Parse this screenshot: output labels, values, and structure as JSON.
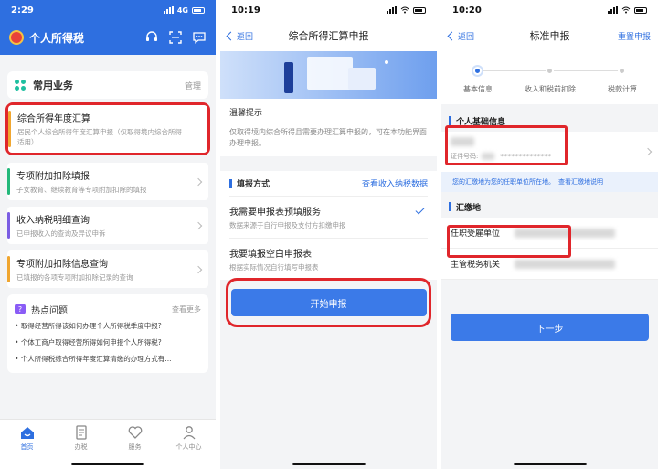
{
  "panel1": {
    "status": {
      "time": "2:29",
      "net": "4G"
    },
    "app_title": "个人所得税",
    "common": {
      "title": "常用业务",
      "manage": "管理"
    },
    "items": [
      {
        "title": "综合所得年度汇算",
        "desc": "居民个人综合所得年度汇算申报（仅取得境内综合所得适用）"
      },
      {
        "title": "专项附加扣除填报",
        "desc": "子女教育、继续教育等专项附加扣除的填报"
      },
      {
        "title": "收入纳税明细查询",
        "desc": "已申报收入的查询及异议申诉"
      },
      {
        "title": "专项附加扣除信息查询",
        "desc": "已填报的各项专项附加扣除记录的查询"
      }
    ],
    "hot": {
      "title": "热点问题",
      "more": "查看更多",
      "items": [
        "取得经营所得该如何办理个人所得税季度申报?",
        "个体工商户取得经营所得如何申报个人所得税?",
        "个人所得税综合所得年度汇算清缴的办理方式有..."
      ]
    },
    "tabs": [
      {
        "label": "首页",
        "icon": "home-icon"
      },
      {
        "label": "办税",
        "icon": "document-icon"
      },
      {
        "label": "服务",
        "icon": "heart-icon"
      },
      {
        "label": "个人中心",
        "icon": "person-icon"
      }
    ]
  },
  "panel2": {
    "status": {
      "time": "10:19"
    },
    "back": "返回",
    "title": "综合所得汇算申报",
    "tip": {
      "title": "温馨提示",
      "desc": "仅取得境内综合所得且需要办理汇算申报的，可在本功能界面办理申报。"
    },
    "fill": {
      "title": "填报方式",
      "link": "查看收入纳税数据",
      "options": [
        {
          "title": "我需要申报表预填服务",
          "desc": "数据来源于自行申报及支付方扣缴申报"
        },
        {
          "title": "我要填报空白申报表",
          "desc": "根据实际情况自行填写申报表"
        }
      ]
    },
    "start": "开始申报"
  },
  "panel3": {
    "status": {
      "time": "10:20"
    },
    "back": "返回",
    "title": "标准申报",
    "reset": "重置申报",
    "steps": [
      "基本信息",
      "收入和税前扣除",
      "税款计算"
    ],
    "basic": {
      "title": "个人基础信息",
      "id_label": "证件号码:",
      "id_mask": "**************"
    },
    "note": {
      "text": "您的汇缴地为您的任职单位所在地。",
      "link": "查看汇缴地说明"
    },
    "remit": {
      "title": "汇缴地",
      "employer": "任职受雇单位",
      "tax_office": "主管税务机关"
    },
    "next": "下一步"
  }
}
